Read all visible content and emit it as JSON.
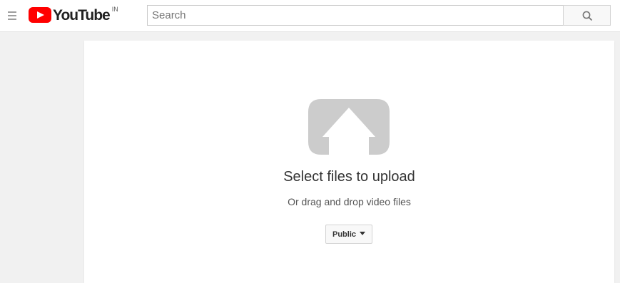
{
  "header": {
    "logo_text": "YouTube",
    "country_code": "IN",
    "search": {
      "placeholder": "Search",
      "value": ""
    }
  },
  "upload": {
    "title": "Select files to upload",
    "subtitle": "Or drag and drop video files",
    "privacy_label": "Public"
  },
  "icons": {
    "menu": "hamburger-menu-icon",
    "logo": "youtube-logo-icon",
    "search": "search-icon",
    "upload": "upload-arrow-icon",
    "dropdown": "caret-down-icon"
  },
  "colors": {
    "brand_red": "#ff0000",
    "page_background": "#f1f1f1",
    "card_background": "#ffffff",
    "upload_icon": "#cccccc"
  }
}
